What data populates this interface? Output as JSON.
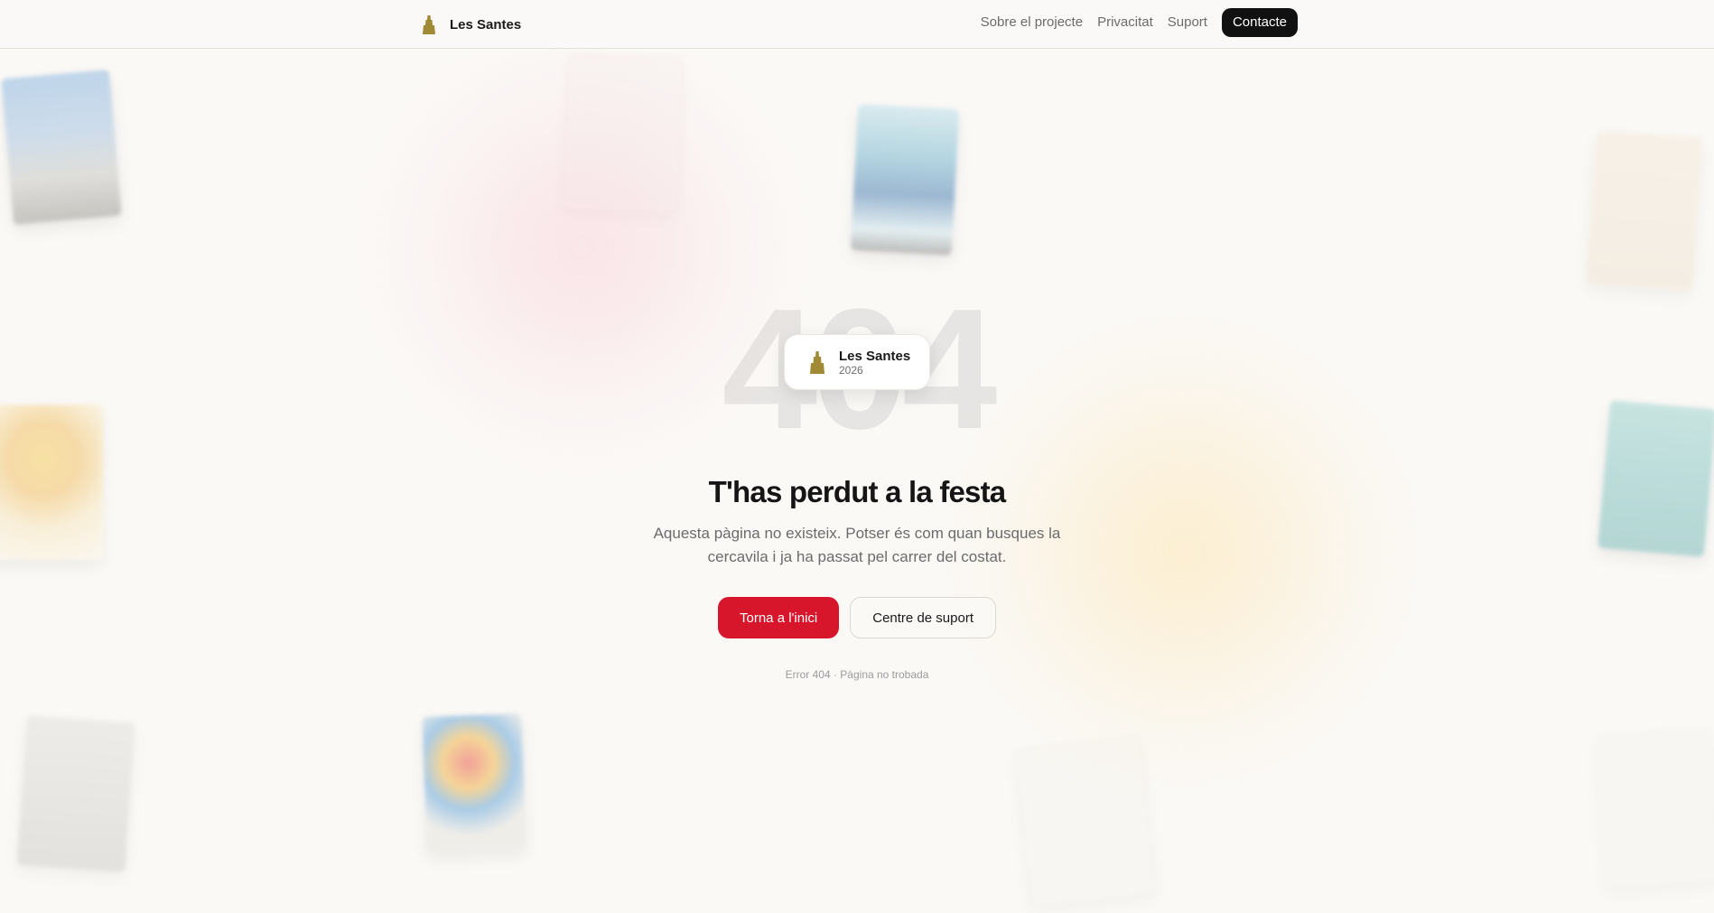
{
  "header": {
    "brand_name": "Les Santes",
    "nav": [
      "Sobre el projecte",
      "Privacitat",
      "Suport"
    ],
    "cta": "Contacte"
  },
  "hero": {
    "big_code": "404",
    "badge": {
      "title": "Les Santes",
      "year": "2026"
    },
    "headline": "T'has perdut a la festa",
    "subtext": "Aquesta pàgina no existeix. Potser és com quan busques la cercavila i ja ha passat pel carrer del costat.",
    "primary_button": "Torna a l'inici",
    "secondary_button": "Centre de suport",
    "error_note": "Error 404 · Pàgina no trobada"
  },
  "colors": {
    "background": "#fbf9f6",
    "primary": "#d8162b",
    "cta": "#111111",
    "brand_icon": "#a08a36"
  },
  "icons": {
    "brand": "tower-icon",
    "badge": "tower-icon"
  }
}
